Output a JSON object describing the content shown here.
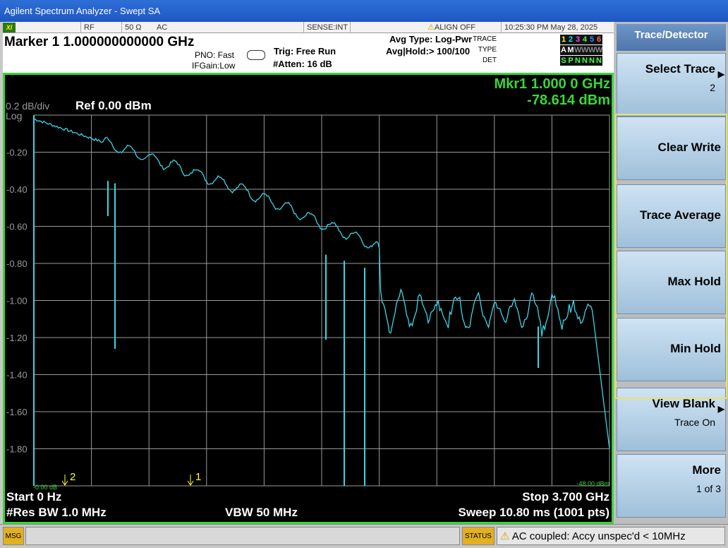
{
  "window": {
    "title": "Agilent Spectrum Analyzer - Swept SA"
  },
  "infobar": {
    "rf": "RF",
    "impedance": "50 Ω",
    "coupling": "AC",
    "sense": "SENSE:INT",
    "align": "ALIGN OFF",
    "datetime": "10:25:30 PM May 28, 2025"
  },
  "header": {
    "marker_title": "Marker 1  1.000000000000 GHz",
    "pno": "PNO: Fast",
    "ifgain": "IFGain:Low",
    "trig": "Trig: Free Run",
    "atten": "#Atten: 16 dB",
    "avg_type": "Avg Type: Log-Pwr",
    "avg_hold": "Avg|Hold:> 100/100",
    "trace_label": "TRACE",
    "type_label": "TYPE",
    "det_label": "DET",
    "trace_nums": [
      "1",
      "2",
      "3",
      "4",
      "5",
      "6"
    ],
    "type_vals": [
      "A",
      "M",
      "W",
      "W",
      "W",
      "W"
    ],
    "det_vals": [
      "S",
      "P",
      "N",
      "N",
      "N",
      "N"
    ],
    "trace_colors": [
      "#ffff00",
      "#00e5ff",
      "#ff44ff",
      "#44ff44",
      "#4488ff",
      "#ff6666"
    ]
  },
  "display": {
    "scale": "0.2 dB/div",
    "scale_type": "Log",
    "ref_level": "Ref 0.00 dBm",
    "marker_readout_freq": "Mkr1 1.000 0 GHz",
    "marker_readout_amp": "-78.614 dBm",
    "y_ticks": [
      "-0.20",
      "-0.40",
      "-0.60",
      "-0.80",
      "-1.00",
      "-1.20",
      "-1.40",
      "-1.60",
      "-1.80"
    ],
    "bottom_level": "-48.00 dBm",
    "left_offset": "-0.00 dB",
    "marker1_label": "1",
    "marker2_label": "2",
    "start": "Start 0 Hz",
    "stop": "Stop 3.700 GHz",
    "rbw": "#Res BW 1.0 MHz",
    "vbw": "VBW 50 MHz",
    "sweep": "Sweep  10.80 ms (1001 pts)"
  },
  "colors": {
    "trace": "#3ad6e6",
    "border": "#3ad63a",
    "grid": "#9a9a9a",
    "marker_readout": "#3ad63a",
    "marker_label": "#ffff40"
  },
  "softkeys": {
    "title": "Trace/Detector",
    "items": [
      {
        "label": "Select Trace",
        "sub": "2",
        "arrow": "▶"
      },
      {
        "label": "Clear Write",
        "sub": "",
        "arrow": ""
      },
      {
        "label": "Trace Average",
        "sub": "",
        "arrow": ""
      },
      {
        "label": "Max Hold",
        "sub": "",
        "arrow": ""
      },
      {
        "label": "Min Hold",
        "sub": "",
        "arrow": ""
      },
      {
        "label": "View Blank",
        "sub": "Trace On",
        "arrow": "▶"
      },
      {
        "label": "More",
        "sub": "1 of 3",
        "arrow": ""
      }
    ]
  },
  "statusbar": {
    "msg": "MSG",
    "status": "STATUS",
    "status_text": "AC coupled: Accy unspec'd < 10MHz"
  }
}
